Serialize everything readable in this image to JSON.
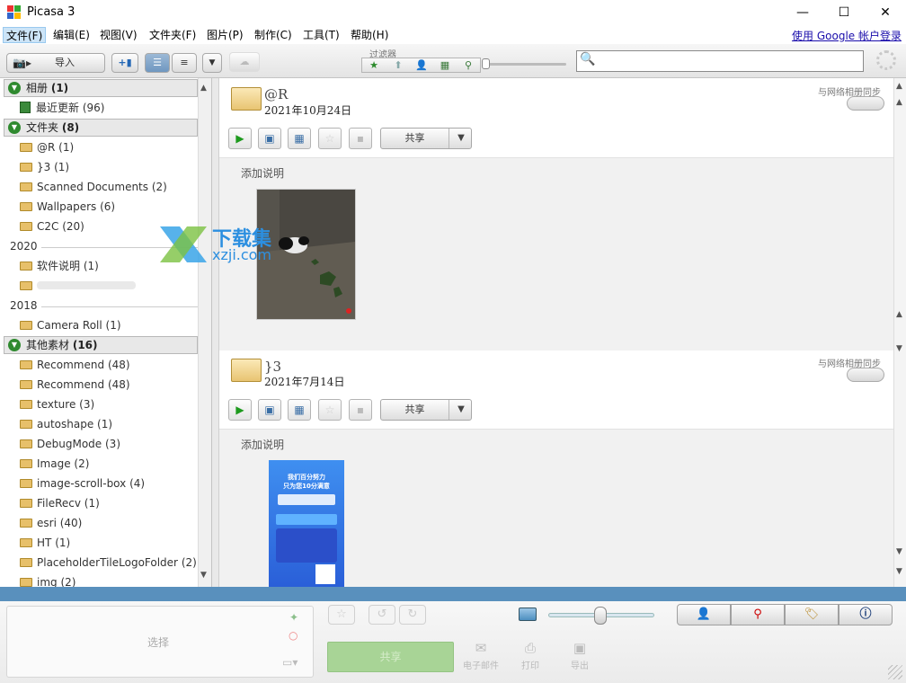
{
  "window": {
    "title": "Picasa 3",
    "controls": {
      "minimize": "—",
      "maximize": "☐",
      "close": "✕"
    }
  },
  "menu": [
    "文件(F)",
    "编辑(E)",
    "视图(V)",
    "文件夹(F)",
    "图片(P)",
    "制作(C)",
    "工具(T)",
    "帮助(H)"
  ],
  "account_link": "使用 Google 帐户登录",
  "toolbar": {
    "import": "导入",
    "filter_label": "过滤器",
    "search_placeholder": ""
  },
  "sidebar": {
    "albums": {
      "title": "相册",
      "count": "(1)",
      "items": [
        {
          "name": "最近更新",
          "count": "(96)"
        }
      ]
    },
    "folders": {
      "title": "文件夹",
      "count": "(8)",
      "items": [
        {
          "name": "@R",
          "count": "(1)"
        },
        {
          "name": "}3",
          "count": "(1)"
        },
        {
          "name": "Scanned Documents",
          "count": "(2)"
        },
        {
          "name": "Wallpapers",
          "count": "(6)"
        },
        {
          "name": "C2C",
          "count": "(20)"
        }
      ],
      "year2020": "2020",
      "items2020": [
        {
          "name": "软件说明",
          "count": "(1)"
        }
      ],
      "year2018": "2018",
      "items2018": [
        {
          "name": "Camera Roll",
          "count": "(1)"
        }
      ]
    },
    "other": {
      "title": "其他素材",
      "count": "(16)",
      "items": [
        {
          "name": "Recommend",
          "count": "(48)"
        },
        {
          "name": "Recommend",
          "count": "(48)"
        },
        {
          "name": "texture",
          "count": "(3)"
        },
        {
          "name": "autoshape",
          "count": "(1)"
        },
        {
          "name": "DebugMode",
          "count": "(3)"
        },
        {
          "name": "Image",
          "count": "(2)"
        },
        {
          "name": "image-scroll-box",
          "count": "(4)"
        },
        {
          "name": "FileRecv",
          "count": "(1)"
        },
        {
          "name": "esri",
          "count": "(40)"
        },
        {
          "name": "HT",
          "count": "(1)"
        },
        {
          "name": "PlaceholderTileLogoFolder",
          "count": "(2)"
        },
        {
          "name": "img",
          "count": "(2)"
        }
      ]
    }
  },
  "main": {
    "folders": [
      {
        "name": "@R",
        "date": "2021年10月24日",
        "sync_label": "与网络相册同步",
        "share": "共享",
        "caption": "添加说明"
      },
      {
        "name": "}3",
        "date": "2021年7月14日",
        "sync_label": "与网络相册同步",
        "share": "共享",
        "caption": "添加说明"
      }
    ],
    "poster": {
      "line1": "我们百分努力",
      "line2": "只为您10分满意"
    }
  },
  "tray": {
    "select": "选择",
    "share": "共享",
    "email": "电子邮件",
    "print": "打印",
    "export": "导出"
  },
  "watermark": {
    "text": "下载集",
    "sub": "xzji.com"
  }
}
